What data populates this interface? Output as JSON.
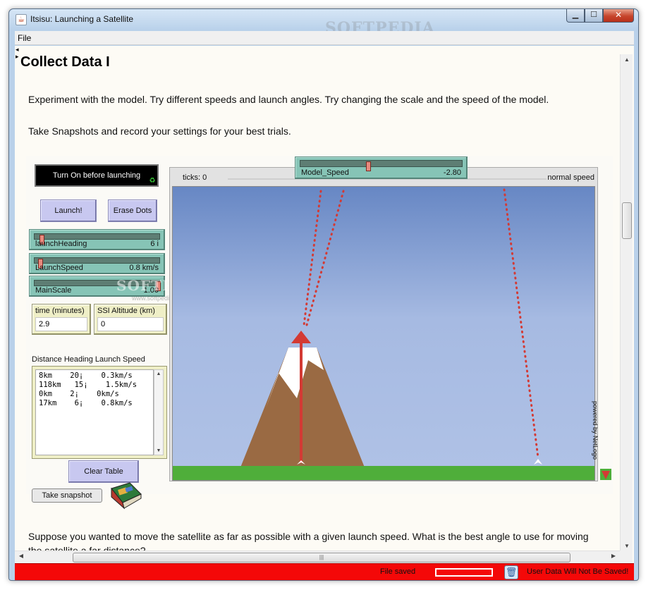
{
  "window": {
    "title": "Itsisu: Launching a Satellite",
    "min_glyph": "▁",
    "max_glyph": "☐",
    "close_glyph": "✕"
  },
  "watermarks": {
    "title": "SOFTPEDIA",
    "main": "SOFTPEDIA",
    "url": "www.softpedia.com"
  },
  "menu": {
    "file": "File"
  },
  "page": {
    "heading": "Collect Data I",
    "p1": "Experiment with the model. Try different speeds and launch angles. Try changing the scale and the speed of the model.",
    "p2": "Take Snapshots and record your settings for your best trials.",
    "p3": "Suppose you wanted to move the satellite as far as possible with a given launch speed. What is the best angle to use for moving",
    "p4": "the satellite a far distance?"
  },
  "applet": {
    "turn_on_label": "Turn On before launching",
    "launch_button": "Launch!",
    "erase_button": "Erase Dots",
    "sliders": [
      {
        "label": "launchHeading",
        "value": "6 i",
        "fraction": 0.04
      },
      {
        "label": "LaunchSpeed",
        "value": "0.8 km/s",
        "fraction": 0.03
      },
      {
        "label": "MainScale",
        "value": "1.00",
        "fraction": 1.0
      }
    ],
    "monitors": [
      {
        "label": "time (minutes)",
        "value": "2.9"
      },
      {
        "label": "SSI Altitude (km)",
        "value": "0"
      }
    ],
    "output_header": "Distance  Heading  Launch Speed",
    "output_rows": [
      "8km    20¡    0.3km/s",
      "118km   15¡    1.5km/s",
      "0km    2¡    0km/s",
      "17km    6¡    0.8km/s"
    ],
    "clear_table_button": "Clear Table",
    "snapshot_button": "Take snapshot",
    "ticks_label": "ticks: 0",
    "normal_speed_label": "normal speed",
    "model_speed": {
      "label": "Model_Speed",
      "value": "-2.80"
    },
    "powered_by": "powered by NetLogo"
  },
  "status": {
    "file_saved": "File saved",
    "user_data": "User Data Will Not Be Saved!",
    "color": "#f40808"
  },
  "scroll": {
    "up": "▲",
    "down": "▼",
    "left": "◀",
    "right": "▶",
    "grip": "|||"
  }
}
